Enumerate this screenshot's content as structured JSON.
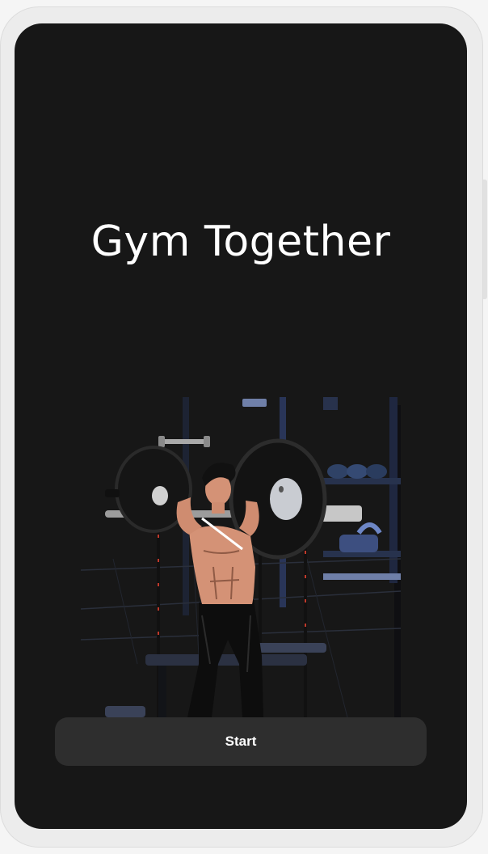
{
  "app": {
    "title": "Gym Together"
  },
  "hero": {
    "illustration": "weightlifter-barbell-illustration"
  },
  "actions": {
    "start_label": "Start"
  },
  "colors": {
    "screen_background": "#171717",
    "button_background": "#2e2e2e",
    "text": "#ffffff"
  }
}
